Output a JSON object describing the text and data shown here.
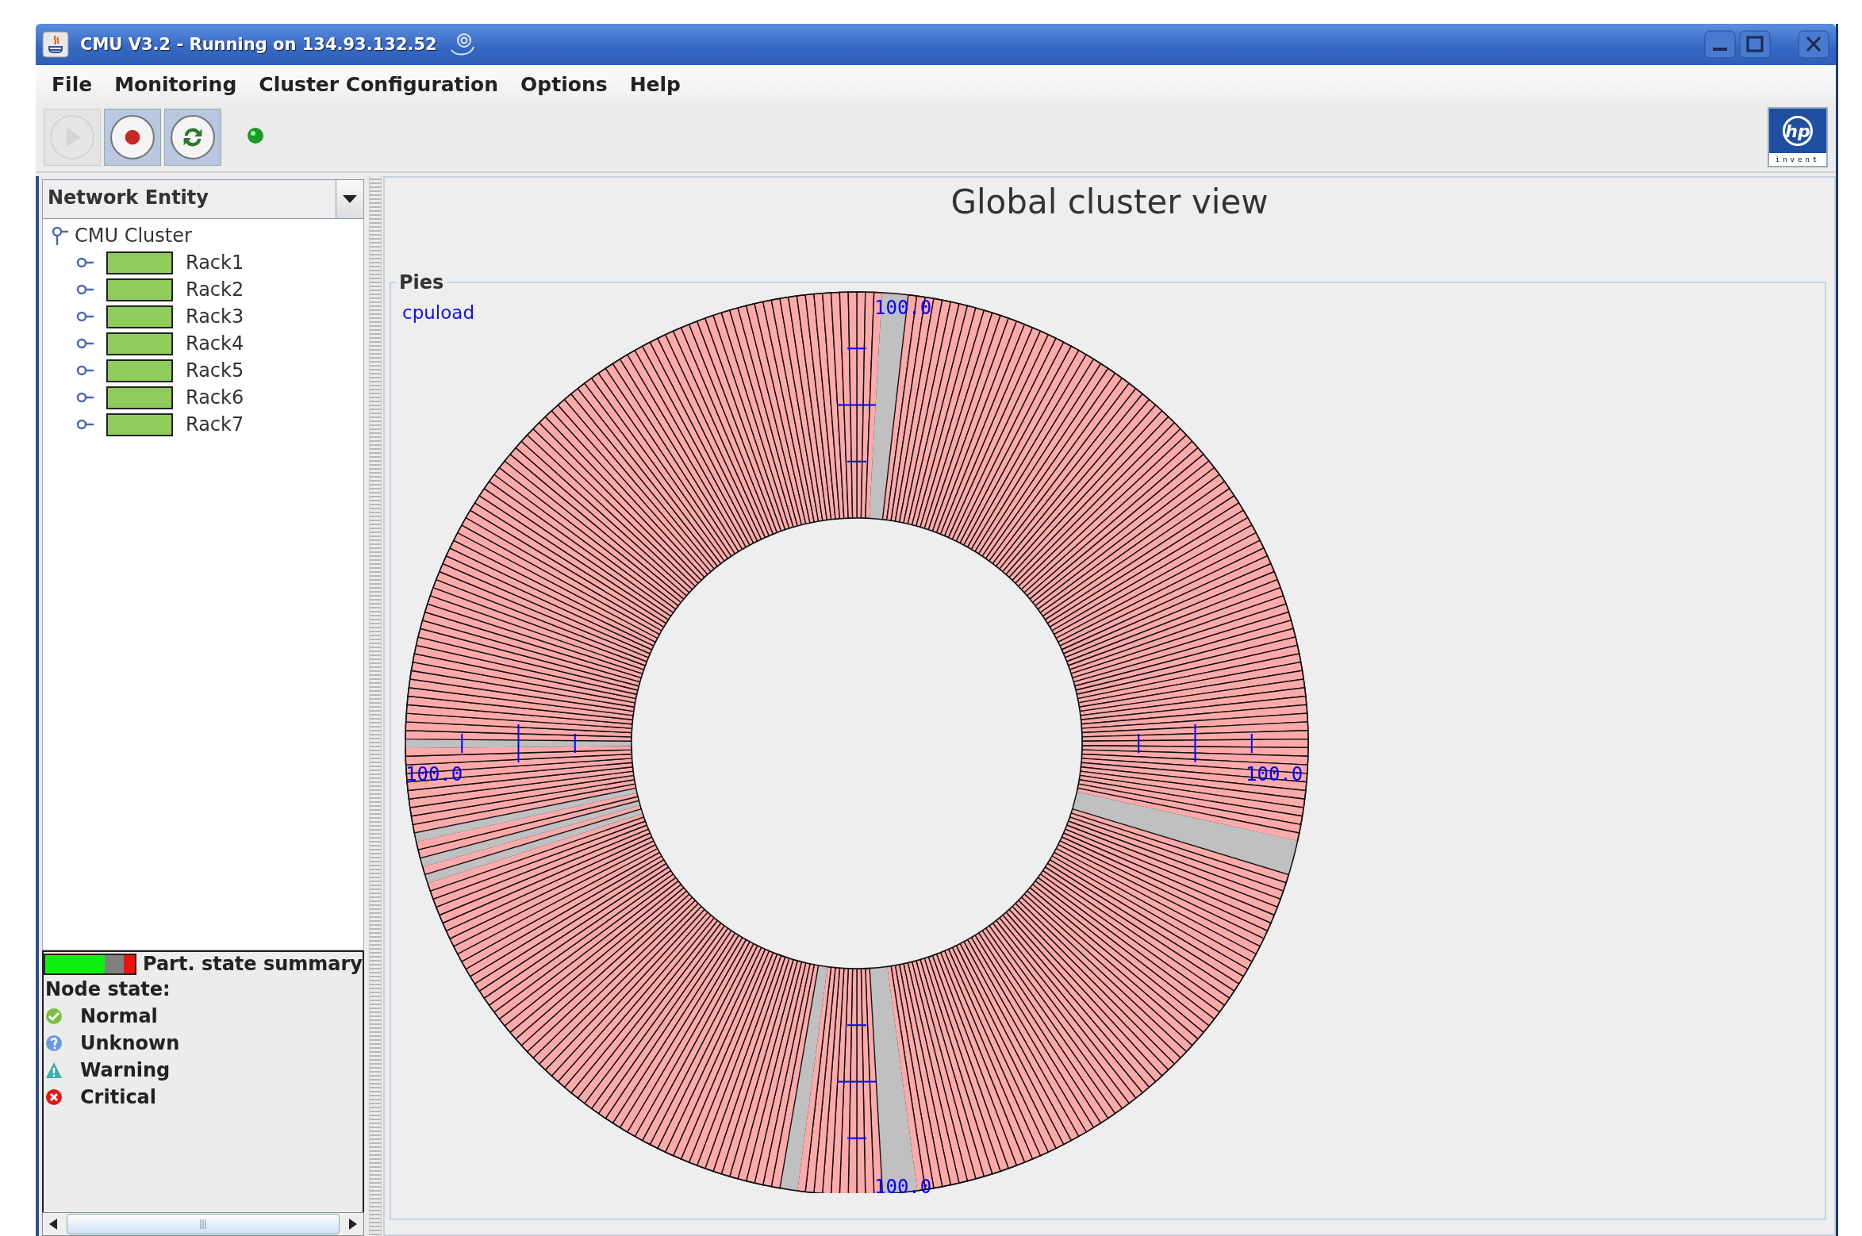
{
  "window": {
    "title": "CMU V3.2 - Running on 134.93.132.52"
  },
  "menu": [
    {
      "label": "File"
    },
    {
      "label": "Monitoring"
    },
    {
      "label": "Cluster Configuration"
    },
    {
      "label": "Options"
    },
    {
      "label": "Help"
    }
  ],
  "toolbar": {
    "buttons": [
      {
        "kind": "play",
        "disabled": true
      },
      {
        "kind": "record",
        "disabled": false
      },
      {
        "kind": "refresh",
        "disabled": false
      }
    ]
  },
  "logo": {
    "mark": "hp",
    "tagline": "invent"
  },
  "sidebar": {
    "selector": {
      "value": "Network Entity"
    },
    "tree": {
      "label": "CMU Cluster",
      "expanded": true,
      "children": [
        {
          "label": "Rack1",
          "color": "#8fcc5c"
        },
        {
          "label": "Rack2",
          "color": "#8fcc5c"
        },
        {
          "label": "Rack3",
          "color": "#8fcc5c"
        },
        {
          "label": "Rack4",
          "color": "#8fcc5c"
        },
        {
          "label": "Rack5",
          "color": "#8fcc5c"
        },
        {
          "label": "Rack6",
          "color": "#8fcc5c"
        },
        {
          "label": "Rack7",
          "color": "#8fcc5c"
        }
      ]
    },
    "summary": {
      "label": "Part. state summary",
      "segments": [
        {
          "color": "#10f010"
        },
        {
          "color": "#808080"
        },
        {
          "color": "#f01010"
        }
      ]
    },
    "legend": {
      "title": "Node state:",
      "items": [
        {
          "kind": "normal",
          "label": "Normal"
        },
        {
          "kind": "unknown",
          "label": "Unknown"
        },
        {
          "kind": "warning",
          "label": "Warning"
        },
        {
          "kind": "critical",
          "label": "Critical"
        }
      ]
    }
  },
  "main": {
    "title": "Global cluster view",
    "group": "Pies",
    "chart": {
      "series_label": "cpuload",
      "axis_labels": [
        "100.0",
        "100.0",
        "100.0",
        "100.0"
      ]
    }
  }
}
